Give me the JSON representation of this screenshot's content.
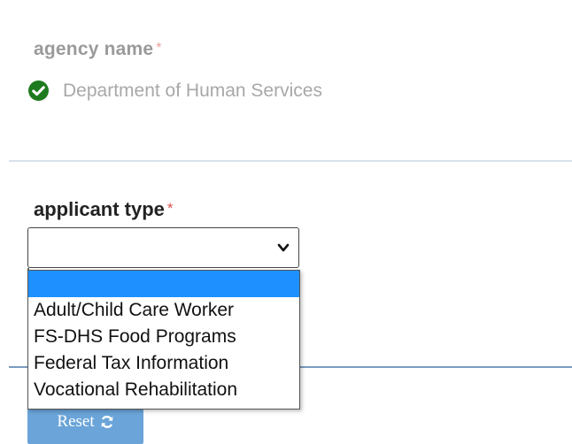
{
  "colors": {
    "check_green": "#1e7a1e",
    "required_mark": "#d9534f",
    "highlight": "#1e90ff",
    "reset_button": "#6aa4d8"
  },
  "agency": {
    "label": "agency name",
    "required_mark": "*",
    "value": "Department of Human Services",
    "status_icon": "check-circle-icon"
  },
  "applicant": {
    "label": "applicant type",
    "required_mark": "*",
    "selected_value": "",
    "dropdown_icon": "chevron-down-icon",
    "options": [
      "",
      "Adult/Child Care Worker",
      "FS-DHS Food Programs",
      "Federal Tax Information",
      "Vocational Rehabilitation"
    ],
    "highlighted_index": 0
  },
  "reset": {
    "label": "Reset",
    "icon": "refresh-icon"
  }
}
